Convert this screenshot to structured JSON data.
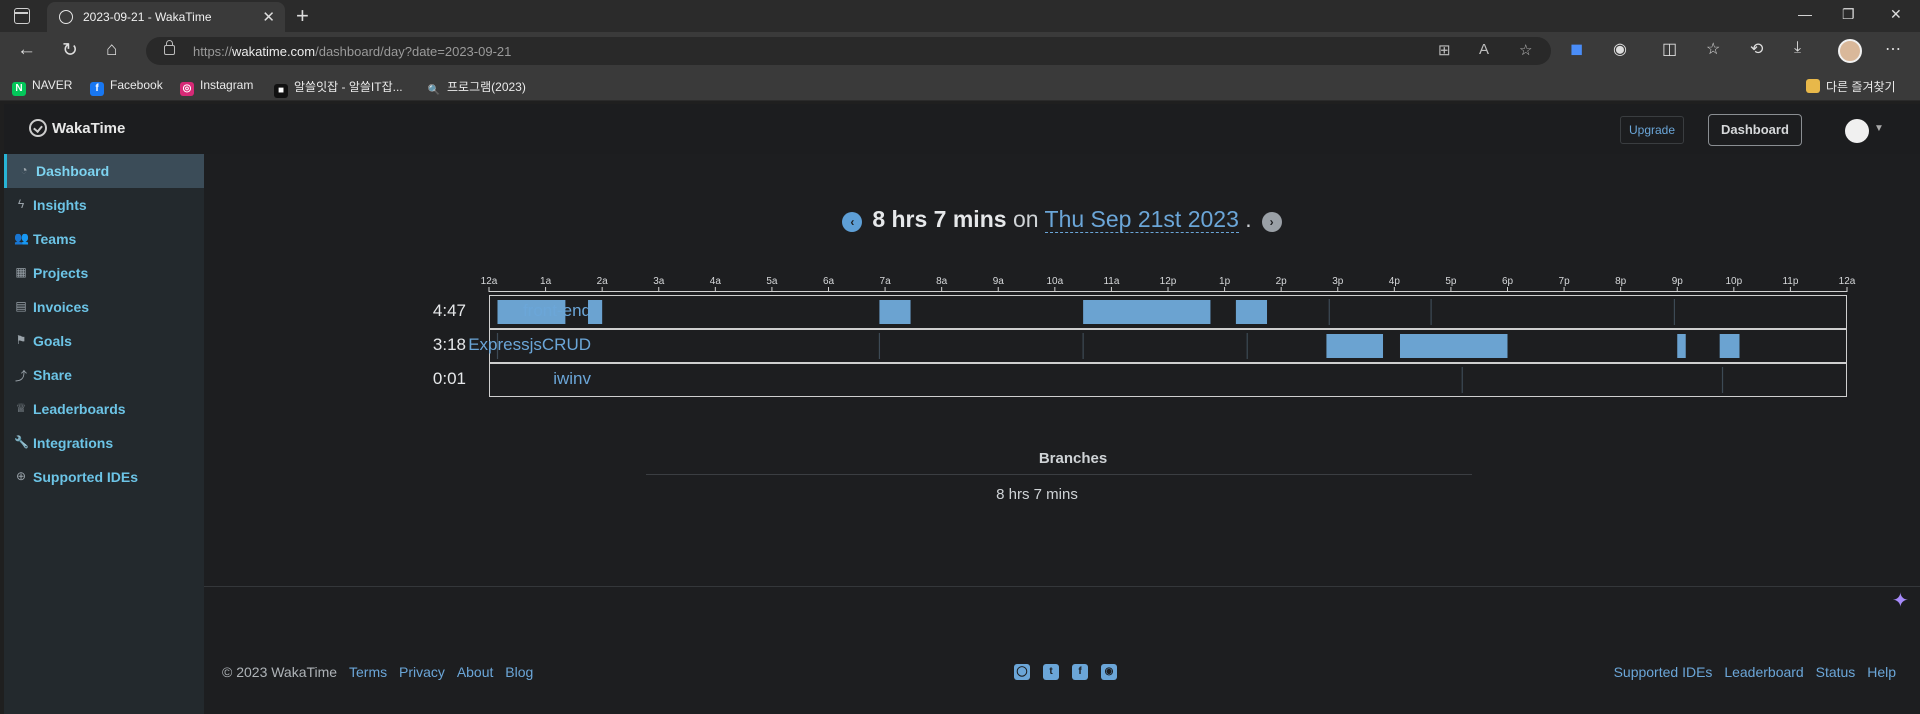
{
  "browser": {
    "tab_title": "2023-09-21 - WakaTime",
    "url_prefix": "https://",
    "url_host": "wakatime.com",
    "url_path": "/dashboard/day?date=2023-09-21",
    "bookmarks": [
      {
        "label": "NAVER",
        "icon": "naver-icon",
        "color": "#03c75a",
        "glyph": "N"
      },
      {
        "label": "Facebook",
        "icon": "facebook-icon",
        "color": "#1877f2",
        "glyph": "f"
      },
      {
        "label": "Instagram",
        "icon": "instagram-icon",
        "color": "#d62976",
        "glyph": "◎"
      },
      {
        "label": "알쓸잇잡 - 알쓸IT잡...",
        "icon": "bookmark-site-icon",
        "color": "#111111",
        "glyph": "■"
      },
      {
        "label": "프로그램(2023)",
        "icon": "search-icon",
        "color": "#3a3a3a",
        "glyph": "🔍"
      }
    ],
    "other_bookmarks": "다른 즐겨찾기"
  },
  "app": {
    "logo": "WakaTime",
    "upgrade": "Upgrade",
    "dashboard": "Dashboard"
  },
  "sidebar": {
    "items": [
      {
        "label": "Dashboard",
        "icon": "dashboard-icon",
        "glyph": "◔",
        "active": true
      },
      {
        "label": "Insights",
        "icon": "bolt-icon",
        "glyph": "ϟ"
      },
      {
        "label": "Teams",
        "icon": "users-icon",
        "glyph": "👥"
      },
      {
        "label": "Projects",
        "icon": "grid-icon",
        "glyph": "▦"
      },
      {
        "label": "Invoices",
        "icon": "file-icon",
        "glyph": "▤"
      },
      {
        "label": "Goals",
        "icon": "flag-icon",
        "glyph": "⚑"
      },
      {
        "label": "Share",
        "icon": "share-icon",
        "glyph": "⤴"
      },
      {
        "label": "Leaderboards",
        "icon": "trophy-icon",
        "glyph": "♕"
      },
      {
        "label": "Integrations",
        "icon": "wrench-icon",
        "glyph": "🔧"
      },
      {
        "label": "Supported IDEs",
        "icon": "plus-circle-icon",
        "glyph": "⊕"
      }
    ]
  },
  "day": {
    "total": "8 hrs 7 mins",
    "on": "on",
    "date": "Thu Sep 21st 2023",
    "period": "."
  },
  "timeline": {
    "hour_labels": [
      "12a",
      "1a",
      "2a",
      "3a",
      "4a",
      "5a",
      "6a",
      "7a",
      "8a",
      "9a",
      "10a",
      "11a",
      "12p",
      "1p",
      "2p",
      "3p",
      "4p",
      "5p",
      "6p",
      "7p",
      "8p",
      "9p",
      "10p",
      "11p",
      "12a"
    ],
    "bar_color": "#6ba3d1",
    "projects": [
      {
        "name": "front-end",
        "time": "4:47",
        "segments": [
          [
            0.15,
            1.35
          ],
          [
            1.75,
            2.0
          ],
          [
            6.9,
            7.45
          ],
          [
            10.5,
            12.75
          ],
          [
            13.2,
            13.75
          ]
        ],
        "ticks": [
          14.85,
          16.65,
          20.95
        ]
      },
      {
        "name": "ExpressjsCRUD",
        "time": "3:18",
        "segments": [
          [
            14.8,
            15.8
          ],
          [
            16.1,
            18.0
          ],
          [
            21.0,
            21.15
          ],
          [
            21.75,
            22.1
          ]
        ],
        "ticks": [
          0.15,
          6.9,
          10.5,
          13.4
        ]
      },
      {
        "name": "iwinv",
        "time": "0:01",
        "segments": [],
        "ticks": [
          17.2,
          21.8
        ]
      }
    ]
  },
  "branches": {
    "title": "Branches",
    "total": "8 hrs 7 mins"
  },
  "footer": {
    "copyright": "© 2023 WakaTime",
    "links_left": [
      "Terms",
      "Privacy",
      "About",
      "Blog"
    ],
    "links_right": [
      "Supported IDEs",
      "Leaderboard",
      "Status",
      "Help"
    ]
  }
}
